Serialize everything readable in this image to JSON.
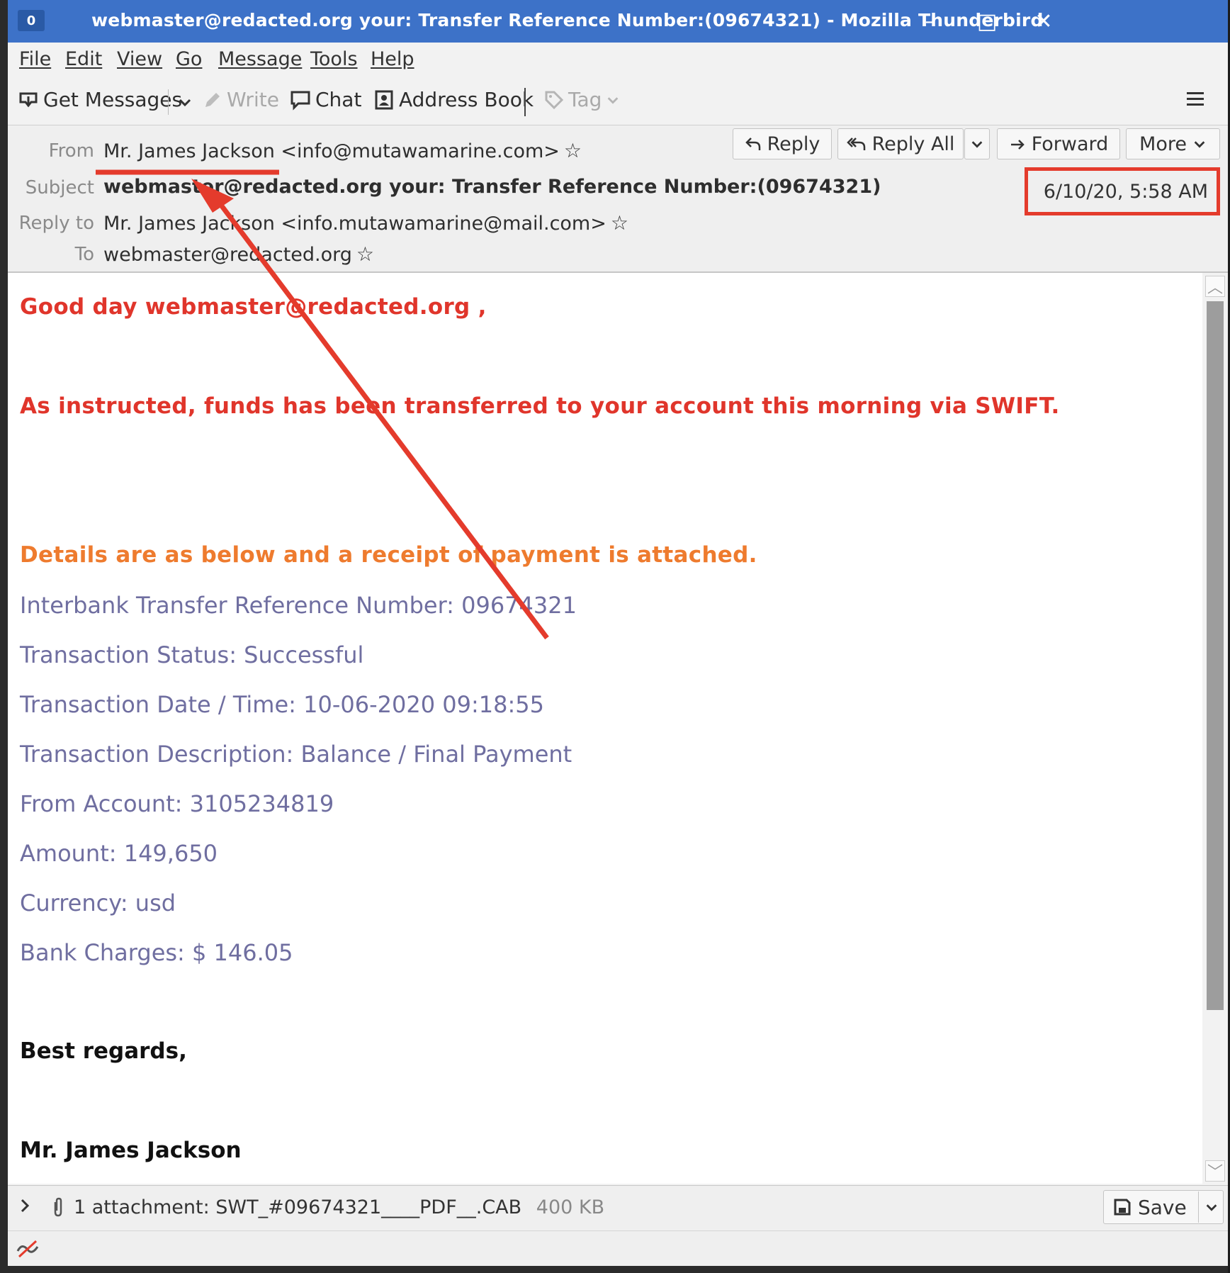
{
  "window": {
    "title": "webmaster@redacted.org your: Transfer Reference Number:(09674321) - Mozilla Thunderbird",
    "badge": "0",
    "controls": [
      "–",
      "□",
      "✕"
    ]
  },
  "menu": [
    "File",
    "Edit",
    "View",
    "Go",
    "Message",
    "Tools",
    "Help"
  ],
  "toolbar": {
    "get_messages": "Get Messages",
    "write": "Write",
    "chat": "Chat",
    "address_book": "Address Book",
    "tag": "Tag"
  },
  "header": {
    "from_label": "From",
    "from_value": "Mr. James Jackson <info@mutawamarine.com>",
    "subject_label": "Subject",
    "subject_value": "webmaster@redacted.org your: Transfer Reference Number:(09674321)",
    "reply_to_label": "Reply to",
    "reply_to_value": "Mr. James Jackson <info.mutawamarine@mail.com>",
    "to_label": "To",
    "to_value": "webmaster@redacted.org",
    "date": "6/10/20, 5:58 AM",
    "buttons": {
      "reply": "Reply",
      "reply_all": "Reply All",
      "forward": "Forward",
      "more": "More"
    }
  },
  "body": {
    "greeting": "Good day webmaster@redacted.org ,",
    "line1": "As instructed, funds has been transferred to your account this morning via SWIFT.",
    "line2": "Details are as below and a receipt of payment is attached.",
    "details": [
      "Interbank Transfer Reference Number: 09674321",
      "Transaction Status: Successful",
      "Transaction Date / Time: 10-06-2020 09:18:55",
      "Transaction Description: Balance / Final Payment",
      "From Account: 3105234819",
      "Amount: 149,650",
      "Currency: usd",
      "Bank Charges: $ 146.05"
    ],
    "closing": "Best regards,",
    "signature": "Mr. James Jackson"
  },
  "attachment": {
    "summary": "1 attachment: SWT_#09674321____PDF__.CAB",
    "size": "400 KB",
    "save": "Save"
  },
  "colors": {
    "titlebar": "#3d72c8",
    "annotation": "#e43b2c",
    "body_red": "#e0352b",
    "body_orange": "#ee7b2e",
    "body_purple": "#6f6ea0"
  }
}
